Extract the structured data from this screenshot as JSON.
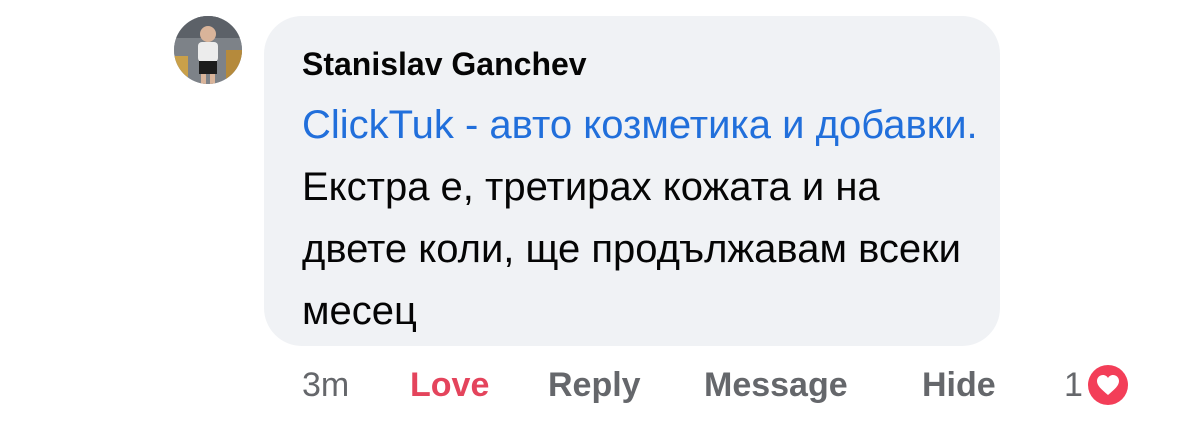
{
  "comment": {
    "author": "Stanislav Ganchev",
    "mention": "ClickTuk - авто козметика и добавки.",
    "text": " Екстра е, третирах кожата и на двете коли, ще продължавам всеки месец"
  },
  "actions": {
    "time": "3m",
    "love": "Love",
    "reply": "Reply",
    "message": "Message",
    "hide": "Hide"
  },
  "reactions": {
    "count": "1",
    "icon": "heart-icon"
  },
  "colors": {
    "bubble": "#f0f2f5",
    "mention": "#216fdb",
    "love": "#e4445c",
    "heart": "#f33e58",
    "muted": "#65676b"
  }
}
